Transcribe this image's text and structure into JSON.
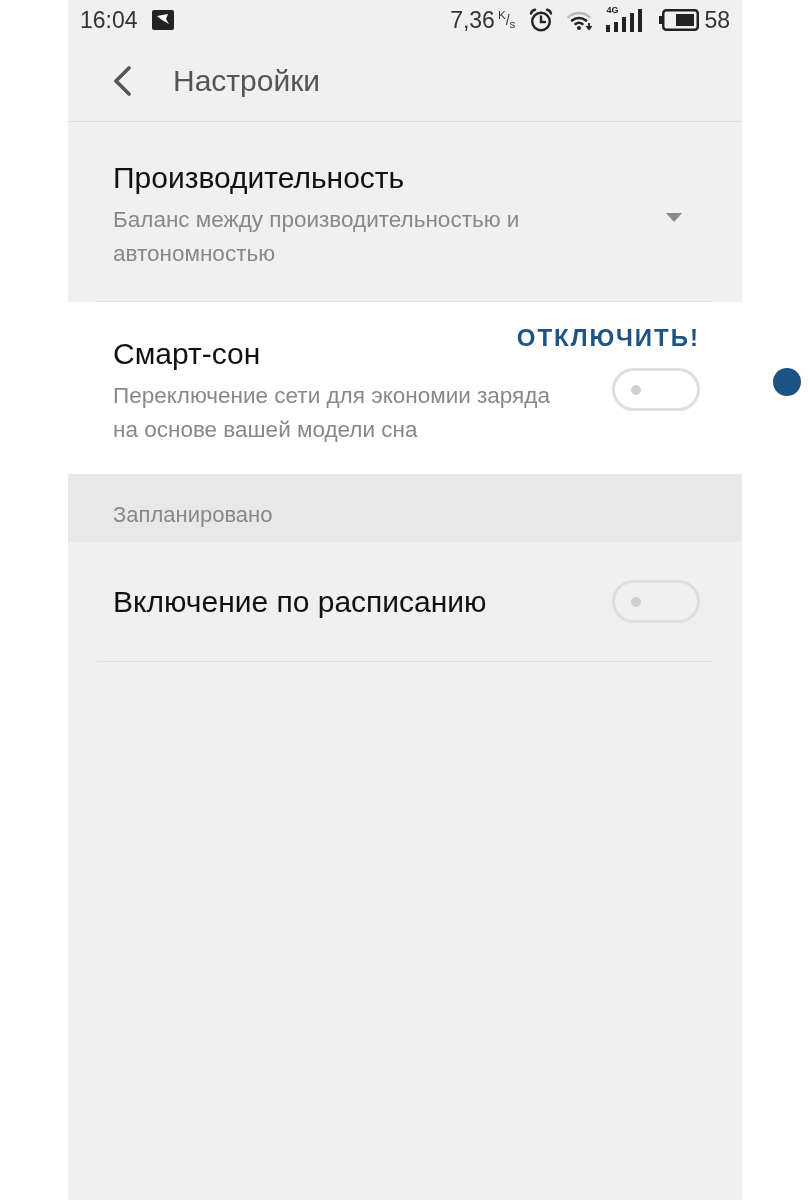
{
  "status_bar": {
    "time": "16:04",
    "speed": "7,36",
    "speed_unit": "$^{K}$/$_{s}$",
    "network": "4G",
    "battery": "58"
  },
  "app_bar": {
    "title": "Настройки"
  },
  "items": [
    {
      "kind": "dropdown",
      "title": "Производительность",
      "value": "Баланс между производительностью и автономностью",
      "highlighted": false
    },
    {
      "kind": "toggle",
      "title": "Смарт-сон",
      "description": "Переключение сети для экономии заряда на основе вашей модели сна",
      "callout": "ОТКЛЮЧИТЬ!",
      "on": false,
      "highlighted": true
    }
  ],
  "sections": [
    {
      "header": "Запланировано",
      "items": [
        {
          "kind": "toggle",
          "title": "Включение по расписанию",
          "on": false,
          "highlighted": false
        }
      ]
    }
  ]
}
